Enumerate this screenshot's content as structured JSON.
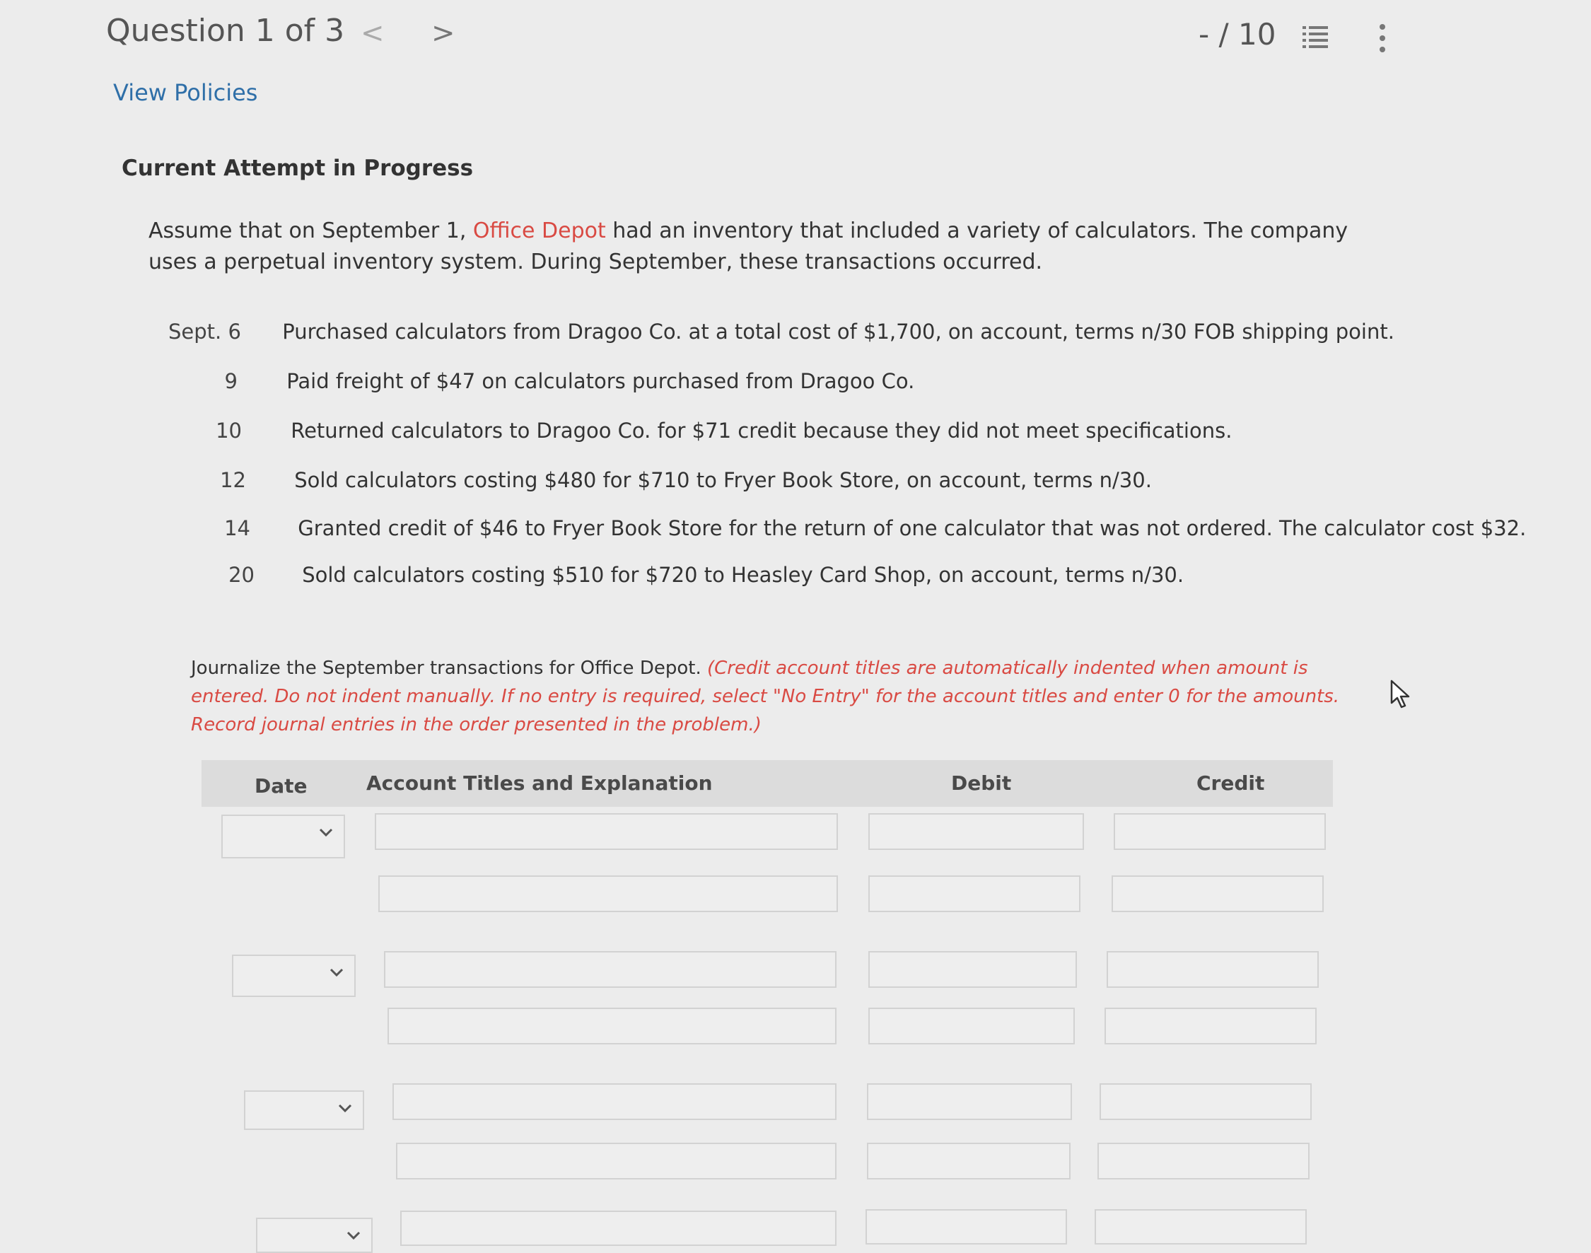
{
  "header": {
    "question_label": "Question 1 of 3",
    "prev_glyph": "<",
    "next_glyph": ">",
    "score": "- / 10"
  },
  "links": {
    "view_policies": "View Policies"
  },
  "attempt_status": "Current Attempt in Progress",
  "intro": {
    "part1": "Assume that on September 1, ",
    "company": "Office Depot",
    "part2": " had an inventory that included a variety of calculators. The company uses a perpetual inventory system. During September, these transactions occurred."
  },
  "transactions": [
    {
      "date": "Sept. 6",
      "text": "Purchased calculators from Dragoo Co. at a total cost of $1,700, on account, terms n/30 FOB shipping point."
    },
    {
      "date": "9",
      "text": "Paid freight of $47 on calculators purchased from Dragoo Co."
    },
    {
      "date": "10",
      "text": "Returned calculators to Dragoo Co. for $71 credit because they did not meet specifications."
    },
    {
      "date": "12",
      "text": "Sold calculators costing $480 for $710 to Fryer Book Store, on account, terms n/30."
    },
    {
      "date": "14",
      "text": "Granted credit of $46 to Fryer Book Store for the return of one calculator that was not ordered. The calculator cost $32."
    },
    {
      "date": "20",
      "text": "Sold calculators costing $510 for $720 to Heasley Card Shop, on account, terms n/30."
    }
  ],
  "instructions": {
    "plain": "Journalize the September transactions for Office Depot. ",
    "red": "(Credit account titles are automatically indented when amount is entered. Do not indent manually. If no entry is required, select \"No Entry\" for the account titles and enter 0 for the amounts. Record journal entries in the order presented in the problem.)"
  },
  "table": {
    "headers": {
      "date": "Date",
      "account": "Account Titles and Explanation",
      "debit": "Debit",
      "credit": "Credit"
    }
  },
  "icons": {
    "list": "list-icon",
    "menu": "kebab-icon",
    "chevron": "chevron-down-icon"
  }
}
